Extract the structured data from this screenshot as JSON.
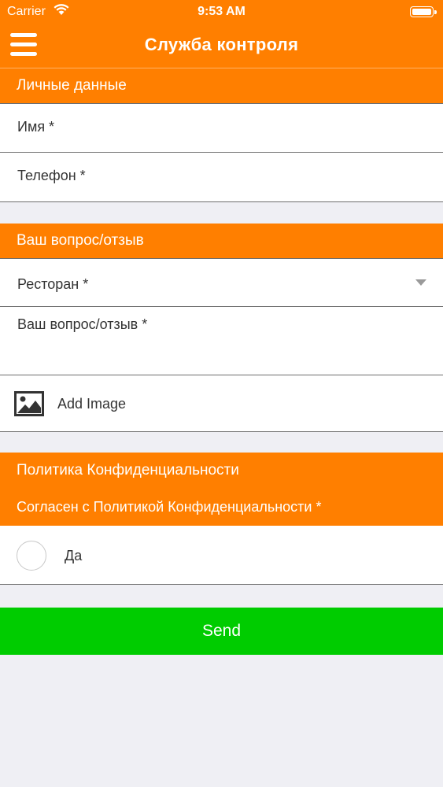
{
  "status_bar": {
    "carrier": "Carrier",
    "time": "9:53 AM"
  },
  "navbar": {
    "title": "Служба контроля"
  },
  "personal_section": {
    "header": "Личные данные",
    "name_placeholder": "Имя *",
    "phone_placeholder": "Телефон *"
  },
  "question_section": {
    "header": "Ваш вопрос/отзыв",
    "restaurant_placeholder": "Ресторан *",
    "question_placeholder": "Ваш вопрос/отзыв *",
    "add_image_label": "Add Image"
  },
  "privacy_section": {
    "header": "Политика Конфиденциальности",
    "agree_label": "Согласен с Политикой Конфиденциальности *",
    "yes_option": "Да"
  },
  "send_label": "Send",
  "colors": {
    "accent": "#ff7f00",
    "send": "#00cc00",
    "background": "#efeff4"
  }
}
